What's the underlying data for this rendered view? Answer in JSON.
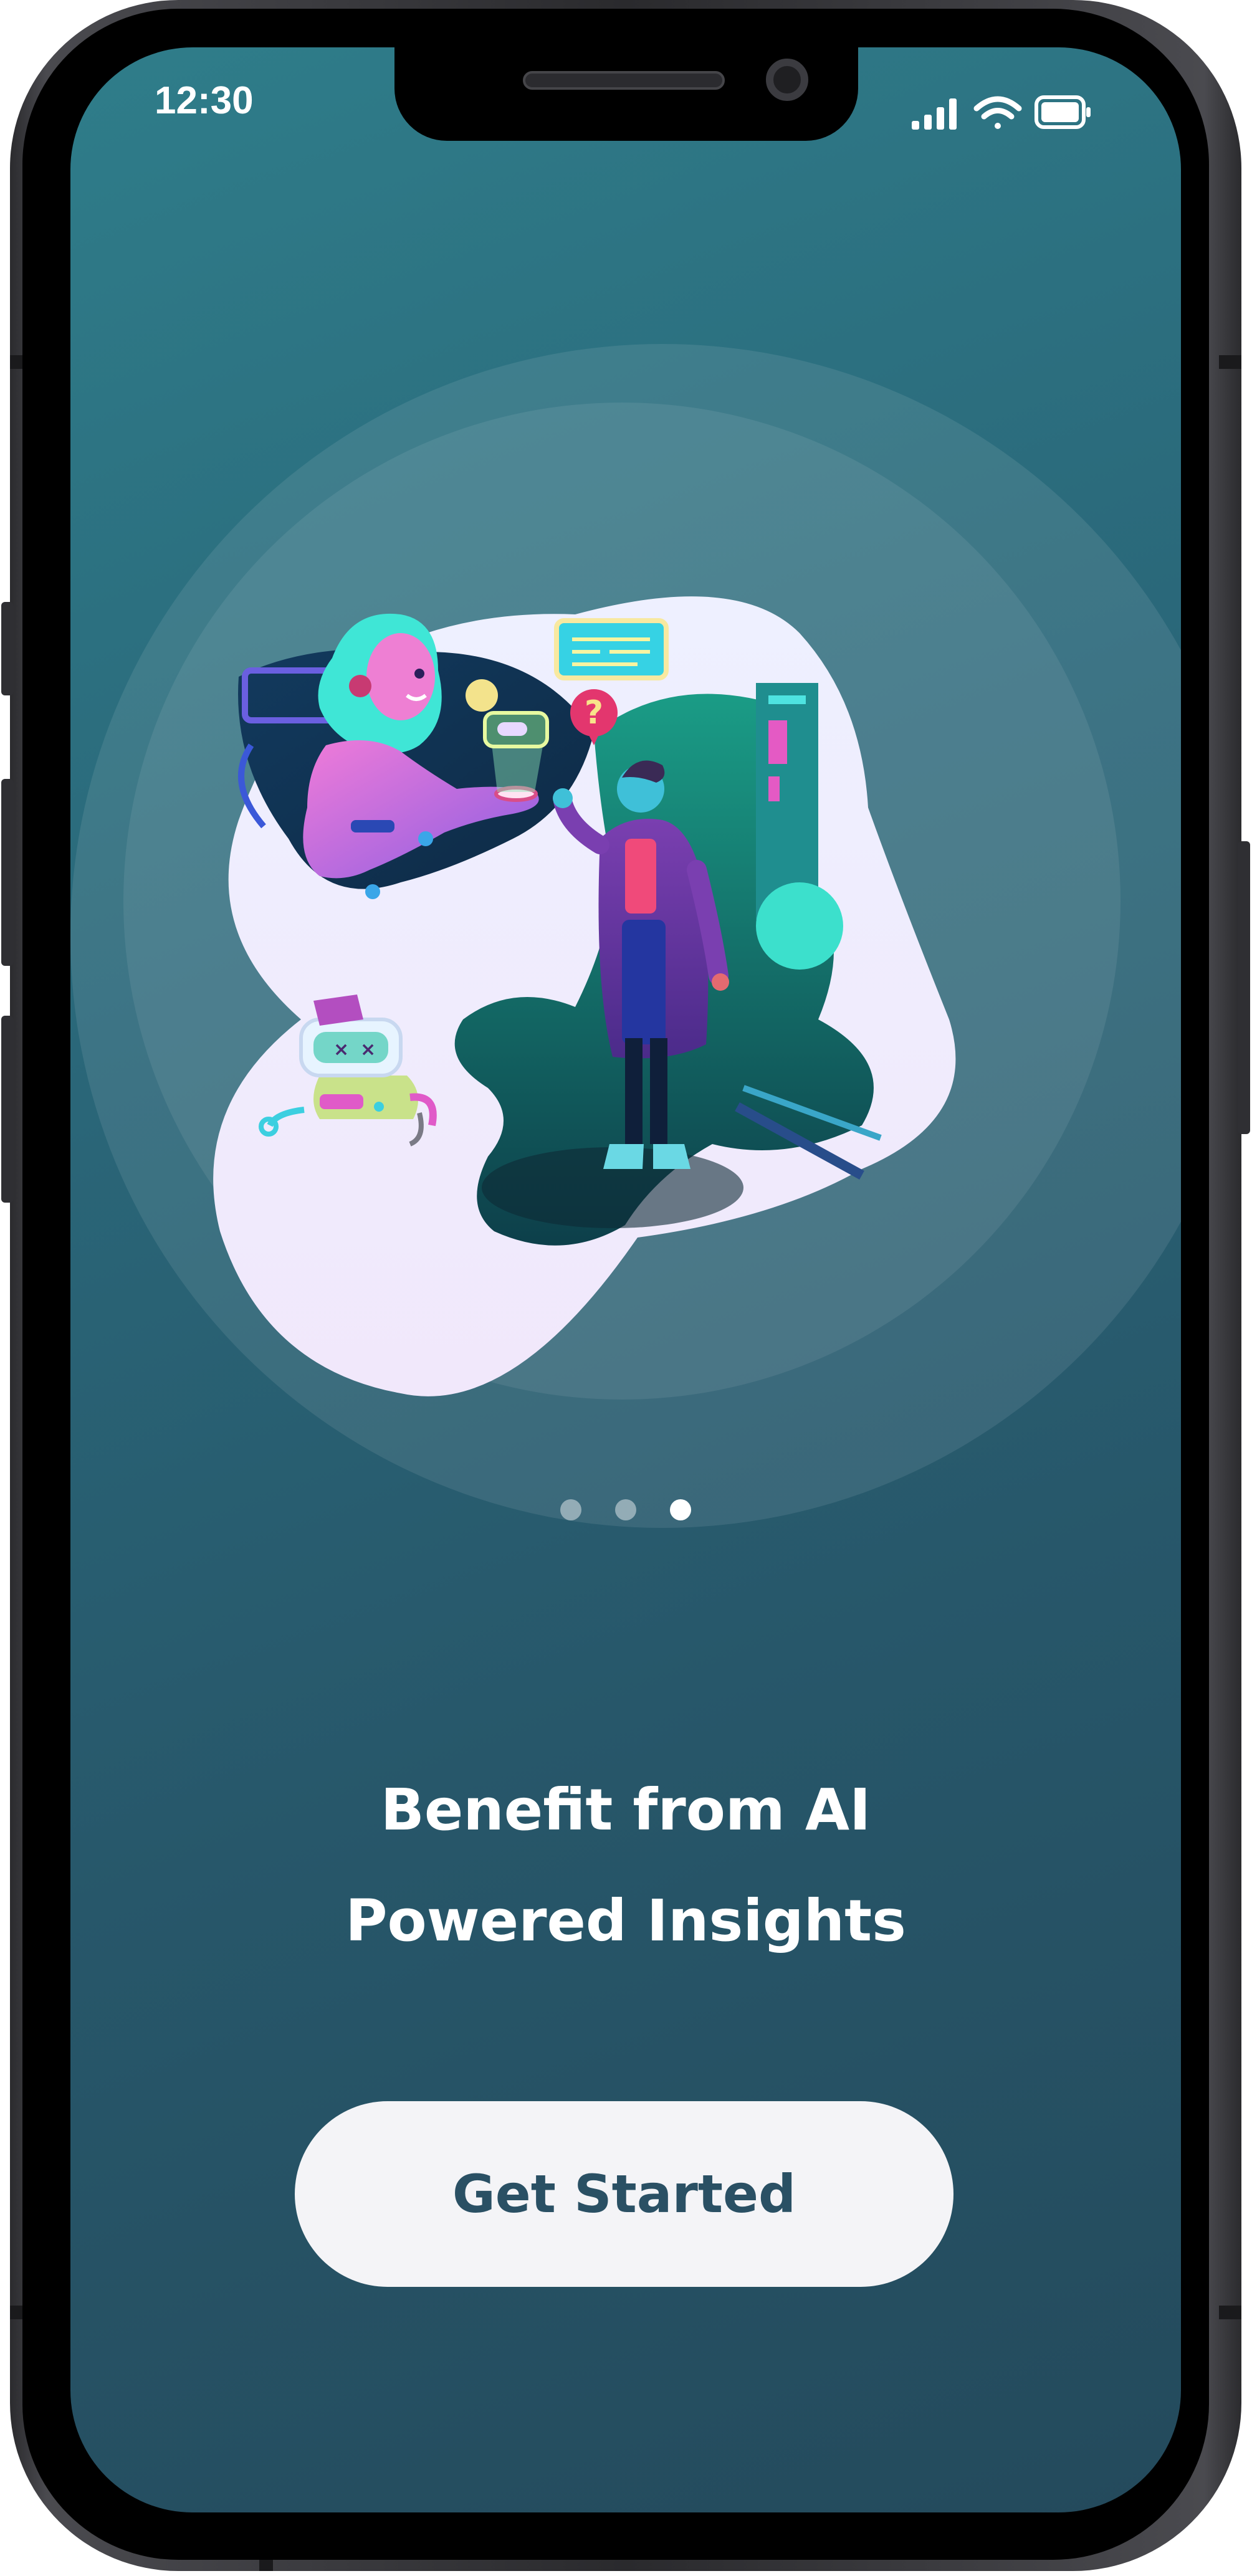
{
  "status_bar": {
    "time": "12:30",
    "icons": [
      "signal-icon",
      "wifi-icon",
      "battery-icon"
    ]
  },
  "pager": {
    "total": 3,
    "active_index": 2
  },
  "onboarding": {
    "headline_line1": "Benefit from AI",
    "headline_line2": "Powered Insights"
  },
  "cta": {
    "label": "Get Started"
  },
  "colors": {
    "background_start": "#2f7d8a",
    "background_end": "#244a5c",
    "button_background": "#f4f4f7",
    "button_text": "#2a5064",
    "dot_active": "#ffffff",
    "dot_inactive": "#8fb0ba"
  }
}
